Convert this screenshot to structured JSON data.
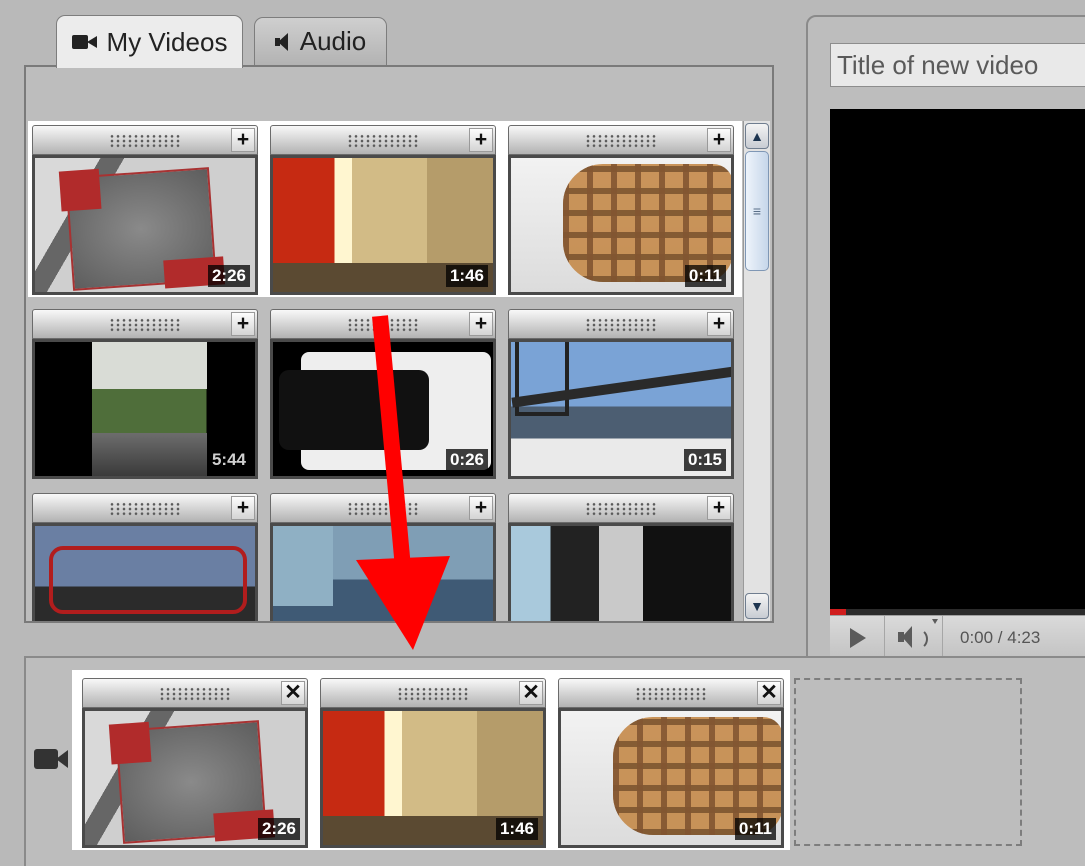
{
  "tabs": [
    {
      "label": "My Videos",
      "icon": "video-camera-icon",
      "active": true
    },
    {
      "label": "Audio",
      "icon": "speaker-icon",
      "active": false
    }
  ],
  "library": {
    "clips": [
      {
        "duration": "2:26",
        "thumb": "waffle-card"
      },
      {
        "duration": "1:46",
        "thumb": "hallway"
      },
      {
        "duration": "0:11",
        "thumb": "waffle"
      },
      {
        "duration": "5:44",
        "thumb": "forest-road"
      },
      {
        "duration": "0:26",
        "thumb": "phone"
      },
      {
        "duration": "0:15",
        "thumb": "bridge"
      },
      {
        "duration": "",
        "thumb": "playground"
      },
      {
        "duration": "",
        "thumb": "rainy-street"
      },
      {
        "duration": "",
        "thumb": "doorway"
      }
    ],
    "add_symbol": "+"
  },
  "preview": {
    "title_placeholder": "Title of new video",
    "time": "0:00 / 4:23",
    "progress": 0.06
  },
  "timeline": {
    "remove_symbol": "✕",
    "clips": [
      {
        "duration": "2:26",
        "thumb": "waffle-card"
      },
      {
        "duration": "1:46",
        "thumb": "hallway"
      },
      {
        "duration": "0:11",
        "thumb": "waffle"
      }
    ]
  },
  "colors": {
    "arrow": "#ff0000",
    "accent": "#d01d1d"
  }
}
